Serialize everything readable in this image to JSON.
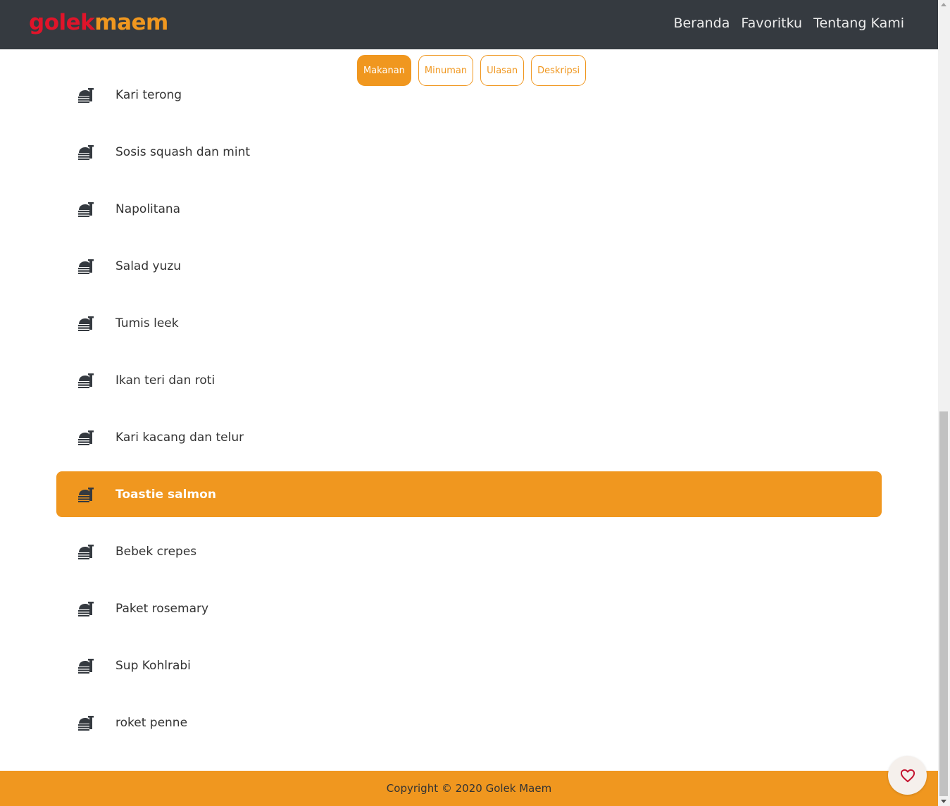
{
  "navbar": {
    "brand_part1": "golek",
    "brand_part2": "maem",
    "links": [
      "Beranda",
      "Favoritku",
      "Tentang Kami"
    ]
  },
  "tabs": [
    {
      "label": "Makanan",
      "active": true
    },
    {
      "label": "Minuman",
      "active": false
    },
    {
      "label": "Ulasan",
      "active": false
    },
    {
      "label": "Deskripsi",
      "active": false
    }
  ],
  "foods": [
    {
      "name": "Kari terong",
      "icon": "food-tray-icon"
    },
    {
      "name": "Sosis squash dan mint",
      "icon": "food-tray-icon"
    },
    {
      "name": "Napolitana",
      "icon": "food-tray-icon"
    },
    {
      "name": "Salad yuzu",
      "icon": "food-tray-icon"
    },
    {
      "name": "Tumis leek",
      "icon": "food-tray-icon"
    },
    {
      "name": "Ikan teri dan roti",
      "icon": "food-tray-icon"
    },
    {
      "name": "Kari kacang dan telur",
      "icon": "food-tray-icon"
    },
    {
      "name": "Toastie salmon",
      "icon": "food-tray-icon",
      "highlighted": true
    },
    {
      "name": "Bebek crepes",
      "icon": "food-tray-icon"
    },
    {
      "name": "Paket rosemary",
      "icon": "food-tray-icon"
    },
    {
      "name": "Sup Kohlrabi",
      "icon": "food-tray-icon"
    },
    {
      "name": "roket penne",
      "icon": "food-tray-icon"
    }
  ],
  "footer": {
    "copyright": "Copyright © 2020 Golek Maem"
  },
  "favorite_button": {
    "icon": "heart-icon"
  },
  "colors": {
    "accent": "#f0971f",
    "navbar": "#353a40",
    "brand_red": "#e0142a"
  }
}
